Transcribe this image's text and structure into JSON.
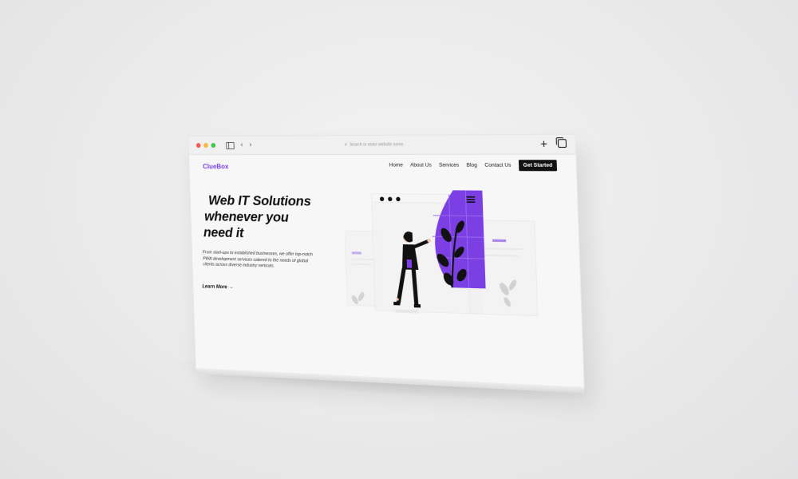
{
  "browser": {
    "address_placeholder": "Search or enter website name",
    "search_icon": "search-icon",
    "back_glyph": "‹",
    "forward_glyph": "›",
    "new_tab_glyph": "+"
  },
  "nav": {
    "logo": "ClueBox",
    "links": [
      "Home",
      "About Us",
      "Services",
      "Blog",
      "Contact Us"
    ],
    "cta": "Get Started"
  },
  "hero": {
    "title_lines": [
      "Web IT Solutions",
      "whenever you",
      "need it"
    ],
    "description": "From start-ups to established businesses, we offer top-notch PWA development services catered to the needs of global clients across diverse industry verticals.",
    "learn_more": "Learn More",
    "learn_more_arrow": "→"
  },
  "colors": {
    "accent": "#7b3fe4",
    "cta_bg": "#111111",
    "dot_red": "#f25b52",
    "dot_yellow": "#f5b83b",
    "dot_green": "#3fc74b"
  }
}
